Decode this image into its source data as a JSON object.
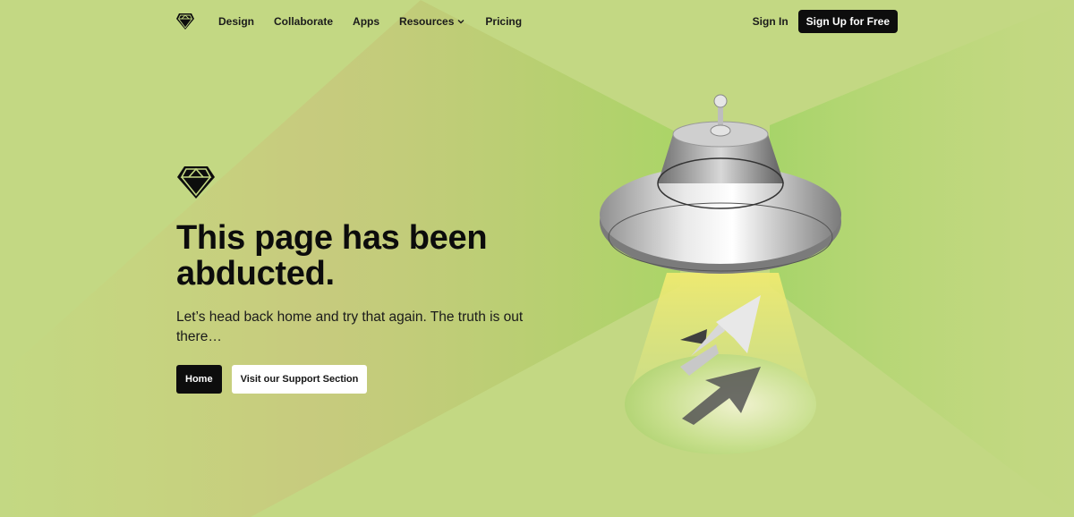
{
  "colors": {
    "background": "#c3d883",
    "beam": "#e6e46a",
    "dark": "#0d0d0d"
  },
  "header": {
    "logo_icon": "diamond-icon",
    "nav": [
      {
        "label": "Design"
      },
      {
        "label": "Collaborate"
      },
      {
        "label": "Apps"
      },
      {
        "label": "Resources",
        "icon": "chevron-down-icon"
      },
      {
        "label": "Pricing"
      }
    ],
    "sign_in": "Sign In",
    "sign_up": "Sign Up for Free"
  },
  "hero": {
    "icon": "diamond-icon",
    "title_line1": "This page has been",
    "title_line2": "abducted.",
    "subtitle": "Let’s head back home and try that again. The truth is out there…",
    "home_button": "Home",
    "support_button": "Visit our Support Section"
  },
  "illustration": {
    "name": "ufo-abducting-cursor"
  }
}
